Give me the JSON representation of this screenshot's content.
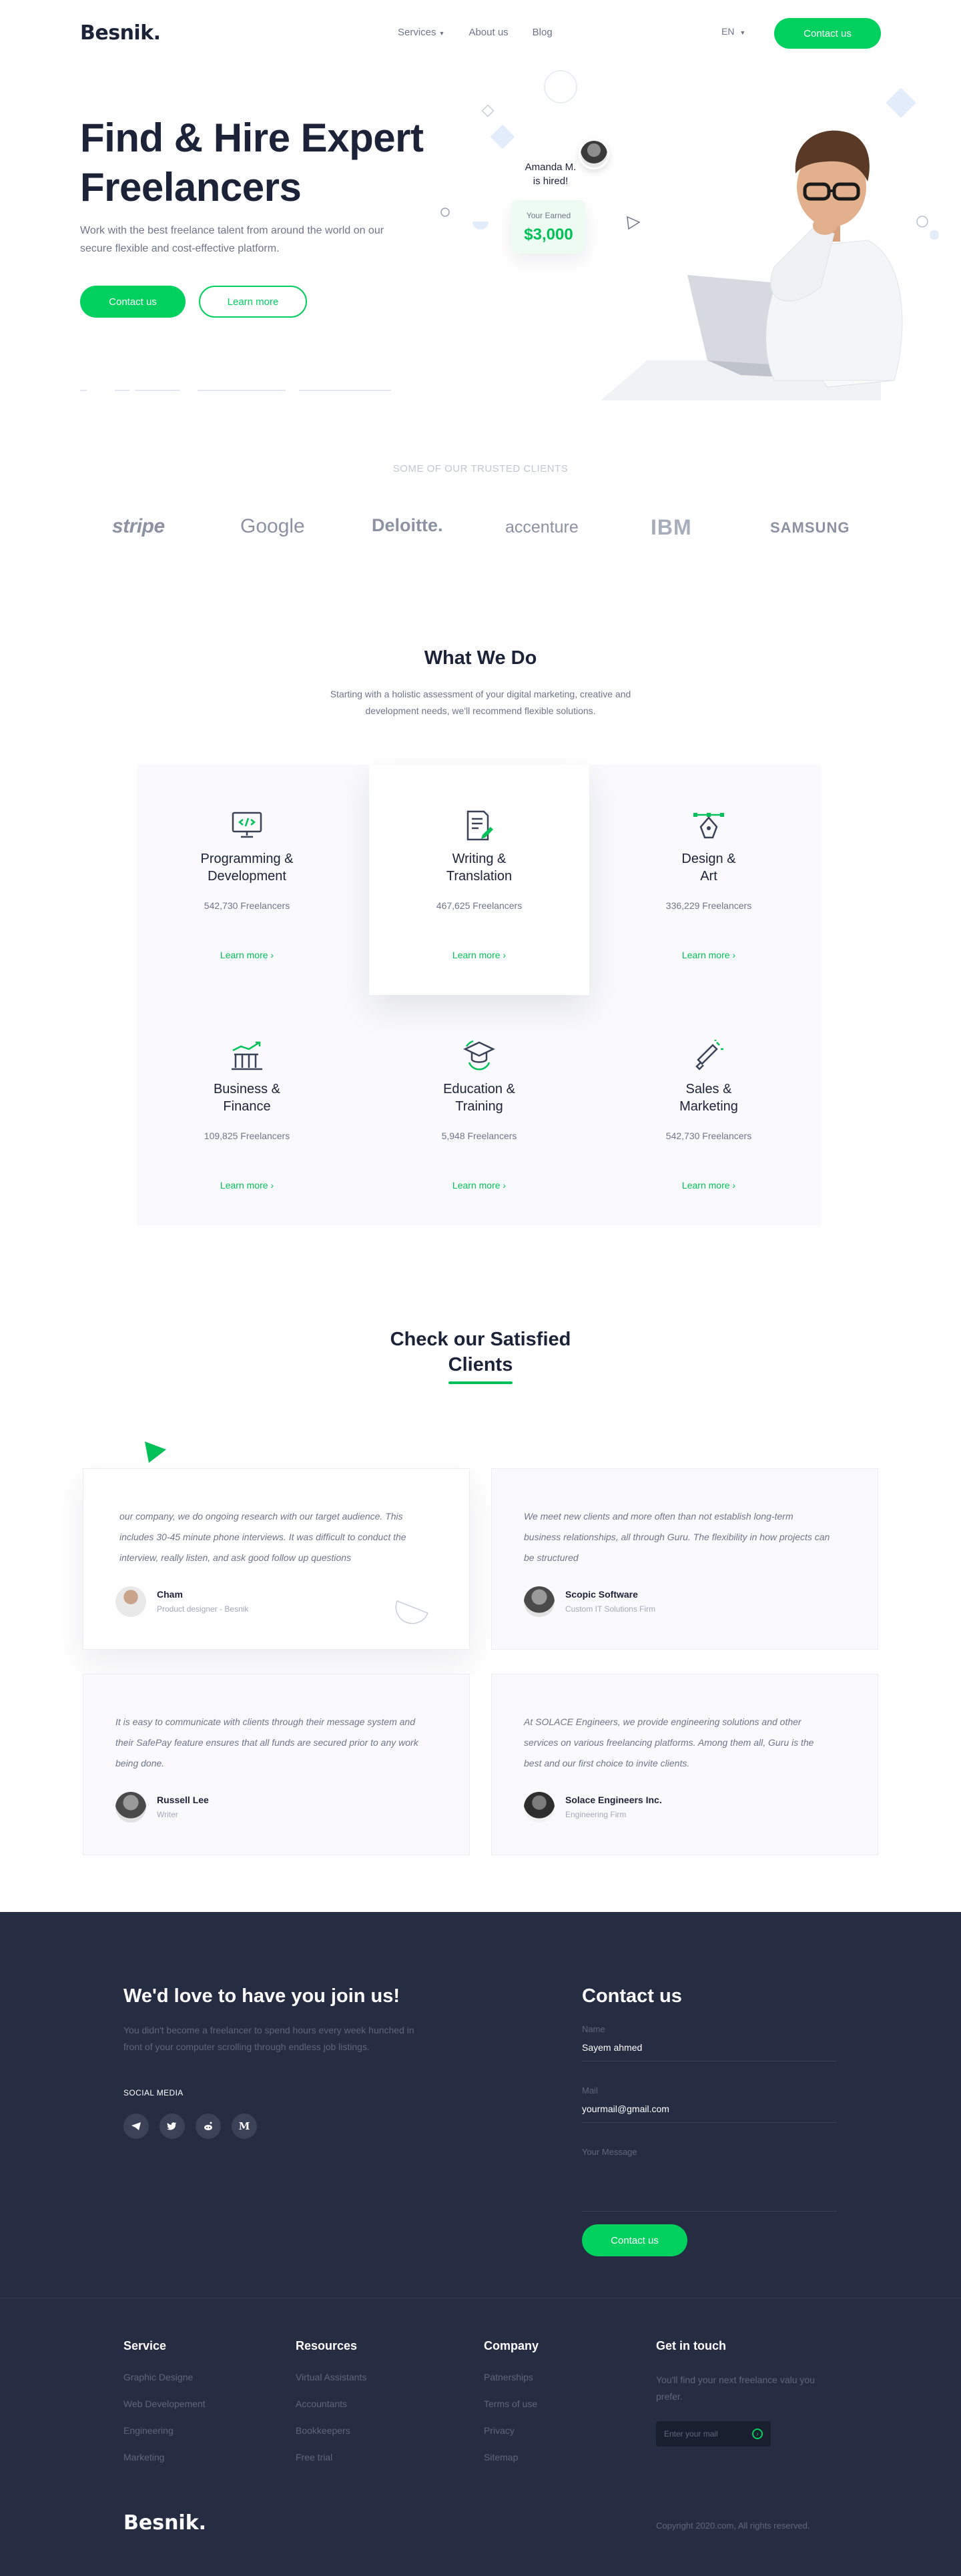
{
  "nav": {
    "logo": "Besnik.",
    "links": [
      "Services",
      "About us",
      "Blog"
    ],
    "lang": "EN",
    "contact": "Contact us"
  },
  "hero": {
    "title_line1": "Find & Hire Expert",
    "title_line2": "Freelancers",
    "subtitle": "Work with the best freelance talent from around the world on our secure flexible and cost-effective platform.",
    "contact": "Contact us",
    "learn": "Learn more",
    "hired_name": "Amanda M.",
    "hired_text": "is hired!",
    "earned_label": "Your Earned",
    "earned_amount": "$3,000"
  },
  "trusted": {
    "title": "SOME OF OUR TRUSTED CLIENTS",
    "clients": [
      "stripe",
      "Google",
      "Deloitte.",
      "accenture",
      "IBM",
      "SAMSUNG"
    ]
  },
  "services": {
    "title": "What We Do",
    "description": "Starting with a holistic assessment of your digital marketing, creative and development needs, we'll recommend flexible solutions.",
    "learn_more": "Learn more ›",
    "items": [
      {
        "line1": "Programming &",
        "line2": "Development",
        "count": "542,730 Freelancers"
      },
      {
        "line1": "Writing &",
        "line2": "Translation",
        "count": "467,625 Freelancers"
      },
      {
        "line1": "Design &",
        "line2": "Art",
        "count": "336,229 Freelancers"
      },
      {
        "line1": "Business &",
        "line2": "Finance",
        "count": "109,825 Freelancers"
      },
      {
        "line1": "Education &",
        "line2": "Training",
        "count": "5,948 Freelancers"
      },
      {
        "line1": "Sales &",
        "line2": "Marketing",
        "count": "542,730 Freelancers"
      }
    ]
  },
  "testimonials": {
    "title_line1": "Check our Satisfied",
    "title_line2": "Clients",
    "items": [
      {
        "quote": "our company, we do ongoing research with our target audience. This includes 30-45 minute phone interviews. It was difficult to conduct the interview, really listen, and ask good follow up questions",
        "name": "Cham",
        "role": "Product designer - Besnik"
      },
      {
        "quote": "We meet new clients and more often than not establish long-term business relationships, all through Guru. The flexibility in how projects can be structured",
        "name": "Scopic Software",
        "role": "Custom IT Solutions Firm"
      },
      {
        "quote": "It is easy to communicate with clients through their message system and their SafePay feature ensures that all funds are secured prior to any work being done.",
        "name": "Russell Lee",
        "role": "Writer"
      },
      {
        "quote": "At SOLACE Engineers, we provide engineering solutions and other services on various freelancing platforms. Among them all, Guru is the best and our first choice to invite clients.",
        "name": "Solace Engineers Inc.",
        "role": "Engineering Firm"
      }
    ]
  },
  "join": {
    "title": "We'd love to have you join us!",
    "text": "You didn't become a freelancer to spend hours every week hunched in front of your computer scrolling through endless job listings.",
    "social_label": "SOCIAL MEDIA"
  },
  "contact": {
    "title": "Contact us",
    "name_label": "Name",
    "name_value": "Sayem ahmed",
    "mail_label": "Mail",
    "mail_value": "yourmail@gmail.com",
    "message_label": "Your Message",
    "button": "Contact us"
  },
  "footer": {
    "service_title": "Service",
    "service_links": [
      "Graphic Designe",
      "Web Developement",
      "Engineering",
      "Marketing"
    ],
    "resources_title": "Resources",
    "resources_links": [
      "Virtual Assistants",
      "Accountants",
      "Bookkeepers",
      "Free trial"
    ],
    "company_title": "Company",
    "company_links": [
      "Patnerships",
      "Terms of use",
      "Privacy",
      "Sitemap"
    ],
    "touch_title": "Get in touch",
    "touch_text": "You'll find your next freelance valu you prefer.",
    "mail_placeholder": "Enter your mail",
    "logo": "Besnik.",
    "copyright": "Copyright 2020.com, All rights reserved."
  },
  "colors": {
    "accent": "#00d15e",
    "dark": "#262c41",
    "heading": "#1c2237"
  }
}
